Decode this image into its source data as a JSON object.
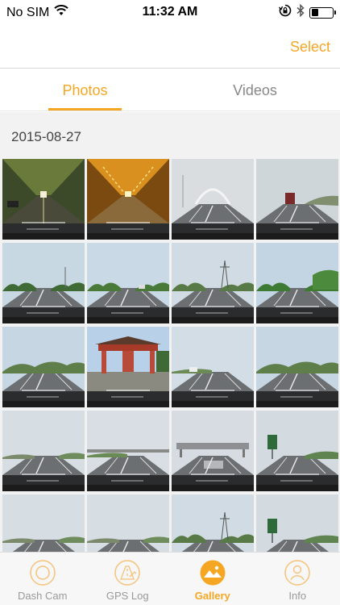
{
  "status_bar": {
    "carrier": "No SIM",
    "time": "11:32 AM",
    "battery_level": 0.35,
    "icons": [
      "wifi-icon",
      "rotation-lock-icon",
      "bluetooth-icon",
      "battery-icon"
    ]
  },
  "nav": {
    "select_label": "Select"
  },
  "tabs": [
    {
      "label": "Photos",
      "active": true
    },
    {
      "label": "Videos",
      "active": false
    }
  ],
  "gallery": {
    "date": "2015-08-27",
    "thumbnails": [
      {
        "scene": "tunnel-green"
      },
      {
        "scene": "tunnel-orange"
      },
      {
        "scene": "bridge"
      },
      {
        "scene": "highway-truck"
      },
      {
        "scene": "road-trees"
      },
      {
        "scene": "road-trees-right"
      },
      {
        "scene": "road-pylons"
      },
      {
        "scene": "road-green"
      },
      {
        "scene": "road-hills"
      },
      {
        "scene": "gate"
      },
      {
        "scene": "road-open"
      },
      {
        "scene": "road-hills"
      },
      {
        "scene": "highway"
      },
      {
        "scene": "highway-overpass"
      },
      {
        "scene": "highway-toll"
      },
      {
        "scene": "highway-sign"
      },
      {
        "scene": "highway"
      },
      {
        "scene": "highway"
      },
      {
        "scene": "road-pylons"
      },
      {
        "scene": "highway-sign"
      }
    ]
  },
  "tab_bar": {
    "items": [
      {
        "label": "Dash Cam",
        "icon": "dash-cam-icon",
        "active": false
      },
      {
        "label": "GPS Log",
        "icon": "gps-log-icon",
        "active": false
      },
      {
        "label": "Gallery",
        "icon": "gallery-icon",
        "active": true
      },
      {
        "label": "Info",
        "icon": "info-icon",
        "active": false
      }
    ]
  },
  "colors": {
    "accent": "#f5a623",
    "inactive": "#999999"
  }
}
